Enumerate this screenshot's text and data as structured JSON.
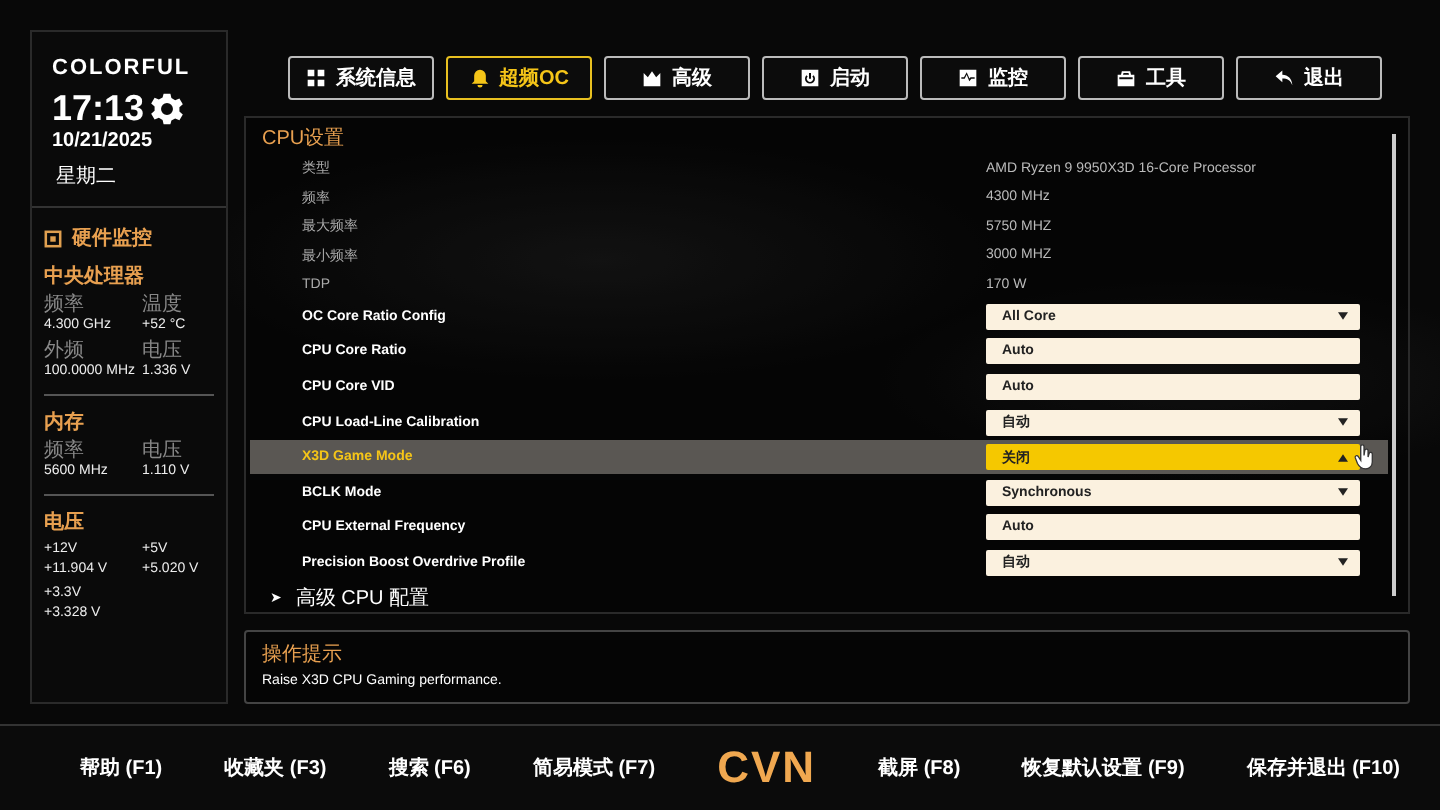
{
  "sidebar": {
    "brand": "COLORFUL",
    "time": "17:13",
    "date": "10/21/2025",
    "weekday": "星期二",
    "monitor_title": "硬件监控",
    "sections": [
      {
        "title": "中央处理器",
        "kind": "stats",
        "items": [
          {
            "label": "频率",
            "value": "4.300 GHz"
          },
          {
            "label": "温度",
            "value": "+52 °C"
          },
          {
            "label": "外频",
            "value": "100.0000 MHz"
          },
          {
            "label": "电压",
            "value": "1.336 V"
          }
        ]
      },
      {
        "title": "内存",
        "kind": "stats",
        "items": [
          {
            "label": "频率",
            "value": "5600 MHz"
          },
          {
            "label": "电压",
            "value": "1.110 V"
          }
        ]
      },
      {
        "title": "电压",
        "kind": "rails",
        "items": [
          {
            "label": "+12V",
            "value": "+11.904 V"
          },
          {
            "label": "+5V",
            "value": "+5.020 V"
          },
          {
            "label": "+3.3V",
            "value": "+3.328 V"
          }
        ]
      }
    ]
  },
  "tabs": [
    {
      "label": "系统信息",
      "selected": false
    },
    {
      "label": "超频OC",
      "selected": true
    },
    {
      "label": "高级",
      "selected": false
    },
    {
      "label": "启动",
      "selected": false
    },
    {
      "label": "监控",
      "selected": false
    },
    {
      "label": "工具",
      "selected": false
    },
    {
      "label": "退出",
      "selected": false
    }
  ],
  "settings": {
    "title": "CPU设置",
    "rows": [
      {
        "label": "类型",
        "kind": "info",
        "value": "AMD Ryzen 9 9950X3D 16-Core Processor",
        "selected": false
      },
      {
        "label": "频率",
        "kind": "info",
        "value": "4300 MHz",
        "selected": false
      },
      {
        "label": "最大频率",
        "kind": "info",
        "value": "5750 MHZ",
        "selected": false
      },
      {
        "label": "最小频率",
        "kind": "info",
        "value": "3000 MHZ",
        "selected": false
      },
      {
        "label": "TDP",
        "kind": "info",
        "value": "170 W",
        "selected": false
      },
      {
        "label": "OC Core Ratio Config",
        "kind": "dropdown",
        "value": "All Core",
        "selected": false
      },
      {
        "label": "CPU Core Ratio",
        "kind": "input",
        "value": "Auto",
        "selected": false
      },
      {
        "label": "CPU Core VID",
        "kind": "input",
        "value": "Auto",
        "selected": false
      },
      {
        "label": "CPU Load-Line Calibration",
        "kind": "dropdown",
        "value": "自动",
        "selected": false
      },
      {
        "label": "X3D Game Mode",
        "kind": "dropdown",
        "value": "关闭",
        "selected": true
      },
      {
        "label": "BCLK Mode",
        "kind": "dropdown",
        "value": "Synchronous",
        "selected": false
      },
      {
        "label": "CPU External Frequency",
        "kind": "input",
        "value": "Auto",
        "selected": false
      },
      {
        "label": "Precision Boost Overdrive Profile",
        "kind": "dropdown",
        "value": "自动",
        "selected": false
      }
    ],
    "submenu": {
      "arrow": "➤",
      "label": "高级 CPU 配置"
    }
  },
  "help": {
    "title": "操作提示",
    "text": "Raise X3D CPU Gaming performance."
  },
  "footer": {
    "left": [
      "帮助 (F1)",
      "收藏夹 (F3)",
      "搜索 (F6)",
      "简易模式 (F7)"
    ],
    "logo": "CVN",
    "right": [
      "截屏 (F8)",
      "恢复默认设置 (F9)",
      "保存并退出 (F10)"
    ]
  }
}
